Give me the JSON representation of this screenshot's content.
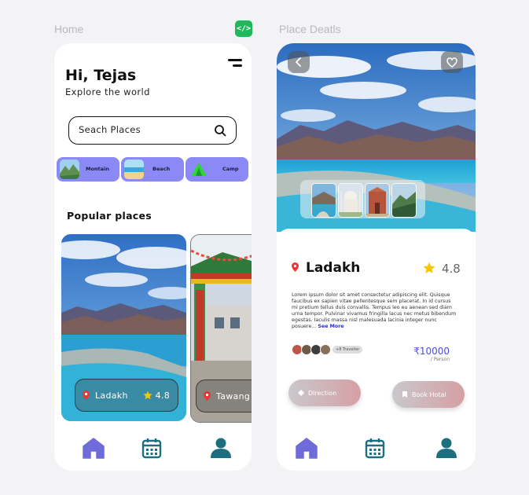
{
  "frames": {
    "home_label": "Home",
    "detail_label": "Place Deatls",
    "code_badge": "</>"
  },
  "home": {
    "greeting": "Hi, Tejas",
    "subtitle": "Explore the world",
    "search": {
      "placeholder": "Seach Places"
    },
    "categories": [
      {
        "label": "Montain",
        "icon": "mountain-thumb"
      },
      {
        "label": "Beach",
        "icon": "beach-thumb"
      },
      {
        "label": "Camp",
        "icon": "tent-icon"
      }
    ],
    "popular_title": "Popular places",
    "places": [
      {
        "name": "Ladakh",
        "rating": "4.8"
      },
      {
        "name": "Tawang"
      }
    ],
    "nav": [
      "home-icon",
      "calendar-icon",
      "profile-icon"
    ]
  },
  "detail": {
    "title": "Ladakh",
    "rating": "4.8",
    "description": "Lorem ipsum dolor sit amet consectetur adipiscing elit. Quisque faucibus ex sapien vitae pellentesque sem placerat. In id cursus mi pretium tellus duis convallis. Tempus leo eu aenean sed diam urna tempor. Pulvinar vivamus fringilla lacus nec metus bibendum egestas. Iaculis massa nisl malesuada lacinia integer nunc posuere...",
    "see_more": "See More",
    "traveller_badge": "+8 Traveller",
    "price": "₹10000",
    "per_person": "/ Person",
    "direction_label": "Direction",
    "book_label": "Book Hotal",
    "colors": {
      "accent": "#8b89f5",
      "nav_home": "#6f6bd8",
      "nav_other": "#1d6f80",
      "price": "#4b4bdc"
    }
  }
}
